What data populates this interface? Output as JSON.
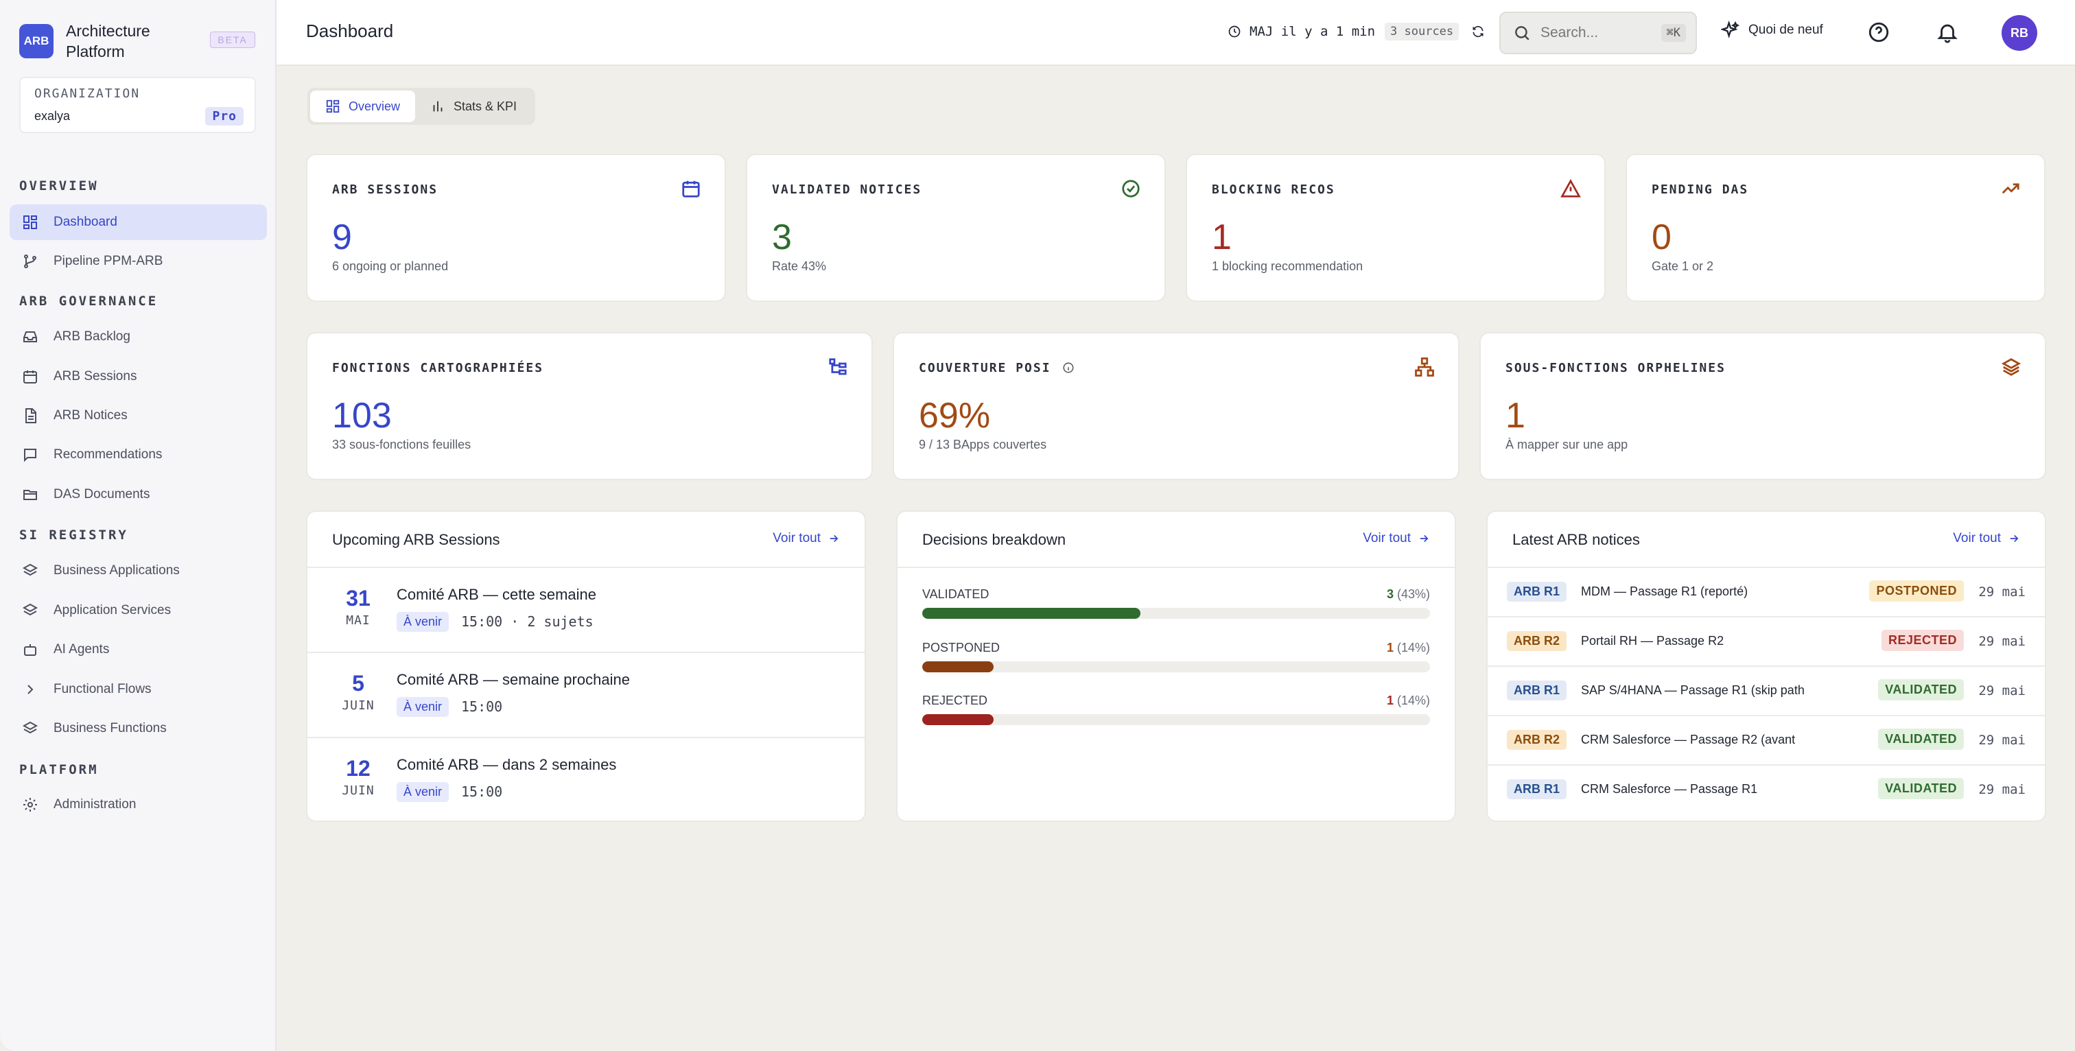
{
  "brand": {
    "logo_text": "ARB",
    "name": "Architecture Platform",
    "badge": "BETA"
  },
  "org": {
    "label": "ORGANIZATION",
    "name": "exalya",
    "plan": "Pro"
  },
  "sidebar": {
    "sections": [
      {
        "title": "OVERVIEW",
        "items": [
          {
            "label": "Dashboard",
            "icon": "grid-icon"
          },
          {
            "label": "Pipeline PPM-ARB",
            "icon": "git-branch-icon"
          }
        ]
      },
      {
        "title": "ARB GOVERNANCE",
        "items": [
          {
            "label": "ARB Backlog",
            "icon": "inbox-icon"
          },
          {
            "label": "ARB Sessions",
            "icon": "calendar-icon"
          },
          {
            "label": "ARB Notices",
            "icon": "file-text-icon"
          },
          {
            "label": "Recommendations",
            "icon": "message-square-icon"
          },
          {
            "label": "DAS Documents",
            "icon": "folder-icon"
          }
        ]
      },
      {
        "title": "SI REGISTRY",
        "items": [
          {
            "label": "Business Applications",
            "icon": "layers-icon"
          },
          {
            "label": "Application Services",
            "icon": "layers-icon"
          },
          {
            "label": "AI Agents",
            "icon": "bot-icon"
          },
          {
            "label": "Functional Flows",
            "icon": "chevron-right-icon"
          },
          {
            "label": "Business Functions",
            "icon": "layers-icon"
          }
        ]
      },
      {
        "title": "PLATFORM",
        "items": [
          {
            "label": "Administration",
            "icon": "gear-icon"
          }
        ]
      }
    ]
  },
  "header": {
    "title": "Dashboard",
    "maj": "MAJ il y a 1 min",
    "sources": "3 sources",
    "search_placeholder": "Search...",
    "search_shortcut": "⌘K",
    "whats_new": "Quoi de neuf",
    "avatar": "RB"
  },
  "tabs": [
    {
      "label": "Overview"
    },
    {
      "label": "Stats & KPI"
    }
  ],
  "kpis_row1": [
    {
      "label": "ARB SESSIONS",
      "value": "9",
      "sub": "6 ongoing or planned"
    },
    {
      "label": "VALIDATED NOTICES",
      "value": "3",
      "sub": "Rate 43%"
    },
    {
      "label": "BLOCKING RECOS",
      "value": "1",
      "sub": "1 blocking recommendation"
    },
    {
      "label": "PENDING DAS",
      "value": "0",
      "sub": "Gate 1 or 2"
    }
  ],
  "kpis_row2": [
    {
      "label": "FONCTIONS CARTOGRAPHIÉES",
      "value": "103",
      "sub": "33 sous-fonctions feuilles"
    },
    {
      "label": "COUVERTURE POSI",
      "value": "69%",
      "sub": "9 / 13 BApps couvertes"
    },
    {
      "label": "SOUS-FONCTIONS ORPHELINES",
      "value": "1",
      "sub": "À mapper sur une app"
    }
  ],
  "sessions": {
    "title": "Upcoming ARB Sessions",
    "link": "Voir tout",
    "items": [
      {
        "day": "31",
        "month": "MAI",
        "title": "Comité ARB — cette semaine",
        "tag": "À venir",
        "time": "15:00 · 2 sujets"
      },
      {
        "day": "5",
        "month": "JUIN",
        "title": "Comité ARB — semaine prochaine",
        "tag": "À venir",
        "time": "15:00"
      },
      {
        "day": "12",
        "month": "JUIN",
        "title": "Comité ARB — dans 2 semaines",
        "tag": "À venir",
        "time": "15:00"
      }
    ]
  },
  "decisions": {
    "title": "Decisions breakdown",
    "link": "Voir tout",
    "items": [
      {
        "label": "VALIDATED",
        "count": "3",
        "pct": "(43%)",
        "fraction": 0.43,
        "color": "#2f6b2f"
      },
      {
        "label": "POSTPONED",
        "count": "1",
        "pct": "(14%)",
        "fraction": 0.14,
        "color": "#8a3f12"
      },
      {
        "label": "REJECTED",
        "count": "1",
        "pct": "(14%)",
        "fraction": 0.14,
        "color": "#9c2320"
      }
    ]
  },
  "notices": {
    "title": "Latest ARB notices",
    "link": "Voir tout",
    "items": [
      {
        "tag": "ARB R1",
        "title": "MDM — Passage R1 (reporté)",
        "status": "POSTPONED",
        "date": "29 mai"
      },
      {
        "tag": "ARB R2",
        "title": "Portail RH — Passage R2",
        "status": "REJECTED",
        "date": "29 mai"
      },
      {
        "tag": "ARB R1",
        "title": "SAP S/4HANA — Passage R1 (skip path",
        "status": "VALIDATED",
        "date": "29 mai"
      },
      {
        "tag": "ARB R2",
        "title": "CRM Salesforce — Passage R2 (avant",
        "status": "VALIDATED",
        "date": "29 mai"
      },
      {
        "tag": "ARB R1",
        "title": "CRM Salesforce — Passage R1",
        "status": "VALIDATED",
        "date": "29 mai"
      }
    ]
  },
  "colors": {
    "accent": "#3646c9",
    "validated": "#2f6b2f",
    "postponed": "#8a3f12",
    "rejected": "#9c2320"
  }
}
